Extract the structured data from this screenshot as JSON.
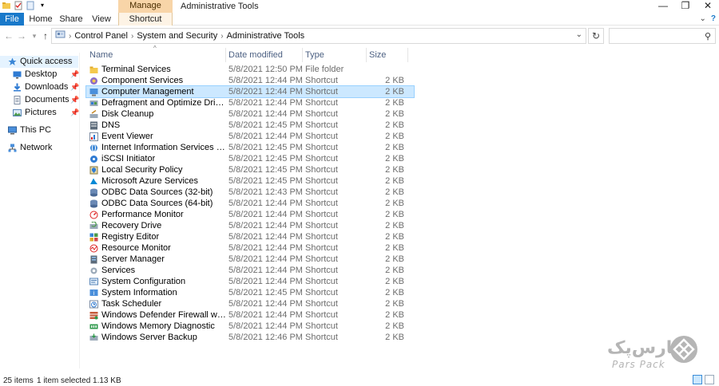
{
  "window": {
    "title": "Administrative Tools",
    "manage_tab": "Manage",
    "minimize": "—",
    "maximize": "❐",
    "close": "✕"
  },
  "ribbon": {
    "tabs": [
      "File",
      "Home",
      "Share",
      "View",
      "Shortcut Tools"
    ],
    "chevron": "⌄",
    "help": "?"
  },
  "address": {
    "crumbs": [
      "Control Panel",
      "System and Security",
      "Administrative Tools"
    ],
    "search_placeholder": ""
  },
  "nav": {
    "items": [
      {
        "label": "Quick access",
        "icon": "star-icon",
        "pinned": false,
        "active": true
      },
      {
        "label": "Desktop",
        "icon": "desktop-icon",
        "pinned": true
      },
      {
        "label": "Downloads",
        "icon": "download-icon",
        "pinned": true
      },
      {
        "label": "Documents",
        "icon": "documents-icon",
        "pinned": true
      },
      {
        "label": "Pictures",
        "icon": "pictures-icon",
        "pinned": true
      },
      {
        "label": "This PC",
        "icon": "computer-icon",
        "pinned": false
      },
      {
        "label": "Network",
        "icon": "network-icon",
        "pinned": false
      }
    ]
  },
  "columns": {
    "name": "Name",
    "date": "Date modified",
    "type": "Type",
    "size": "Size"
  },
  "files": [
    {
      "name": "Terminal Services",
      "date": "5/8/2021 12:50 PM",
      "type": "File folder",
      "size": "",
      "icon": "folder-icon"
    },
    {
      "name": "Component Services",
      "date": "5/8/2021 12:44 PM",
      "type": "Shortcut",
      "size": "2 KB",
      "icon": "component-services-icon"
    },
    {
      "name": "Computer Management",
      "date": "5/8/2021 12:44 PM",
      "type": "Shortcut",
      "size": "2 KB",
      "icon": "computer-management-icon",
      "selected": true
    },
    {
      "name": "Defragment and Optimize Drives",
      "date": "5/8/2021 12:44 PM",
      "type": "Shortcut",
      "size": "2 KB",
      "icon": "defrag-icon"
    },
    {
      "name": "Disk Cleanup",
      "date": "5/8/2021 12:44 PM",
      "type": "Shortcut",
      "size": "2 KB",
      "icon": "disk-cleanup-icon"
    },
    {
      "name": "DNS",
      "date": "5/8/2021 12:45 PM",
      "type": "Shortcut",
      "size": "2 KB",
      "icon": "dns-icon"
    },
    {
      "name": "Event Viewer",
      "date": "5/8/2021 12:44 PM",
      "type": "Shortcut",
      "size": "2 KB",
      "icon": "event-viewer-icon"
    },
    {
      "name": "Internet Information Services (IIS) Manager",
      "date": "5/8/2021 12:45 PM",
      "type": "Shortcut",
      "size": "2 KB",
      "icon": "iis-icon"
    },
    {
      "name": "iSCSI Initiator",
      "date": "5/8/2021 12:45 PM",
      "type": "Shortcut",
      "size": "2 KB",
      "icon": "iscsi-icon"
    },
    {
      "name": "Local Security Policy",
      "date": "5/8/2021 12:45 PM",
      "type": "Shortcut",
      "size": "2 KB",
      "icon": "security-policy-icon"
    },
    {
      "name": "Microsoft Azure Services",
      "date": "5/8/2021 12:45 PM",
      "type": "Shortcut",
      "size": "2 KB",
      "icon": "azure-icon"
    },
    {
      "name": "ODBC Data Sources (32-bit)",
      "date": "5/8/2021 12:43 PM",
      "type": "Shortcut",
      "size": "2 KB",
      "icon": "odbc-icon"
    },
    {
      "name": "ODBC Data Sources (64-bit)",
      "date": "5/8/2021 12:44 PM",
      "type": "Shortcut",
      "size": "2 KB",
      "icon": "odbc-icon"
    },
    {
      "name": "Performance Monitor",
      "date": "5/8/2021 12:44 PM",
      "type": "Shortcut",
      "size": "2 KB",
      "icon": "performance-icon"
    },
    {
      "name": "Recovery Drive",
      "date": "5/8/2021 12:44 PM",
      "type": "Shortcut",
      "size": "2 KB",
      "icon": "recovery-icon"
    },
    {
      "name": "Registry Editor",
      "date": "5/8/2021 12:44 PM",
      "type": "Shortcut",
      "size": "2 KB",
      "icon": "registry-icon"
    },
    {
      "name": "Resource Monitor",
      "date": "5/8/2021 12:44 PM",
      "type": "Shortcut",
      "size": "2 KB",
      "icon": "resource-monitor-icon"
    },
    {
      "name": "Server Manager",
      "date": "5/8/2021 12:44 PM",
      "type": "Shortcut",
      "size": "2 KB",
      "icon": "server-manager-icon"
    },
    {
      "name": "Services",
      "date": "5/8/2021 12:44 PM",
      "type": "Shortcut",
      "size": "2 KB",
      "icon": "services-icon"
    },
    {
      "name": "System Configuration",
      "date": "5/8/2021 12:44 PM",
      "type": "Shortcut",
      "size": "2 KB",
      "icon": "system-config-icon"
    },
    {
      "name": "System Information",
      "date": "5/8/2021 12:45 PM",
      "type": "Shortcut",
      "size": "2 KB",
      "icon": "system-info-icon"
    },
    {
      "name": "Task Scheduler",
      "date": "5/8/2021 12:44 PM",
      "type": "Shortcut",
      "size": "2 KB",
      "icon": "task-scheduler-icon"
    },
    {
      "name": "Windows Defender Firewall with Advanc...",
      "date": "5/8/2021 12:44 PM",
      "type": "Shortcut",
      "size": "2 KB",
      "icon": "firewall-icon"
    },
    {
      "name": "Windows Memory Diagnostic",
      "date": "5/8/2021 12:44 PM",
      "type": "Shortcut",
      "size": "2 KB",
      "icon": "memory-diagnostic-icon"
    },
    {
      "name": "Windows Server Backup",
      "date": "5/8/2021 12:46 PM",
      "type": "Shortcut",
      "size": "2 KB",
      "icon": "backup-icon"
    }
  ],
  "status": {
    "count": "25 items",
    "selection": "1 item selected  1.13 KB"
  },
  "watermark": {
    "text": "پارس‌پک",
    "sub": "Pars Pack"
  },
  "colors": {
    "accent": "#1979ca",
    "selected_row": "#cce8ff",
    "manage_tab": "#f8d5a8"
  }
}
